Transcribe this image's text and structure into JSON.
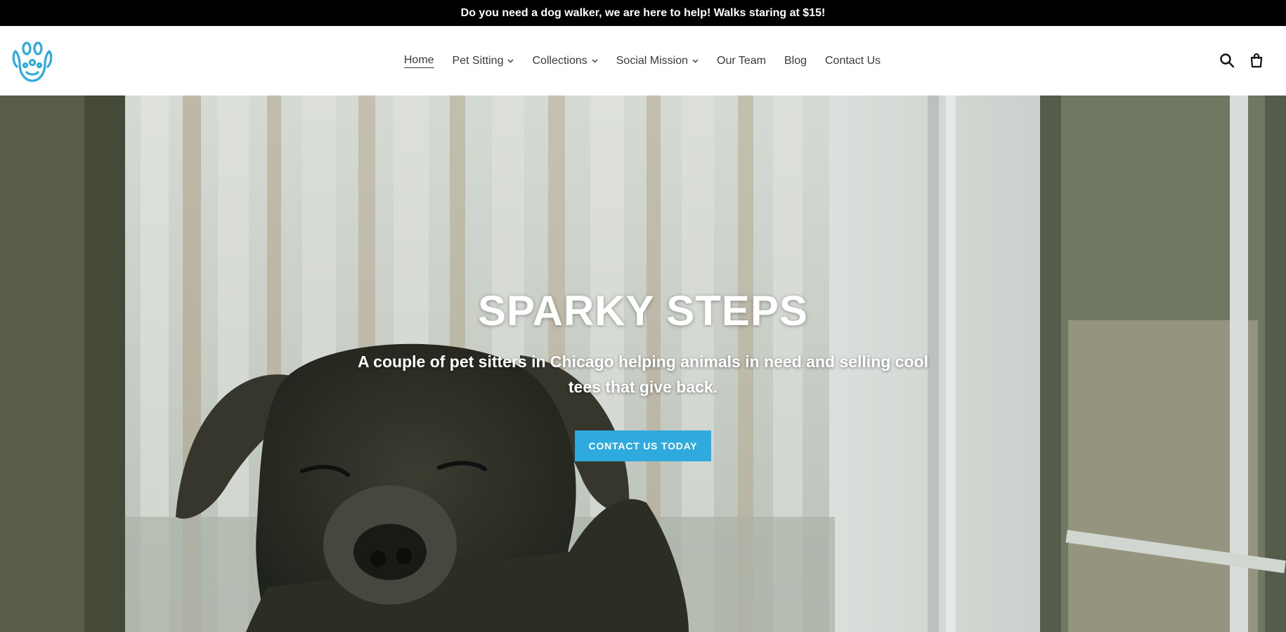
{
  "announcement": {
    "text": "Do you need a dog walker, we are here to help! Walks staring at $15!"
  },
  "header": {
    "logo_icon": "paw-logo-icon",
    "nav": [
      {
        "label": "Home",
        "active": true,
        "dropdown": false
      },
      {
        "label": "Pet Sitting",
        "active": false,
        "dropdown": true
      },
      {
        "label": "Collections",
        "active": false,
        "dropdown": true
      },
      {
        "label": "Social Mission",
        "active": false,
        "dropdown": true
      },
      {
        "label": "Our Team",
        "active": false,
        "dropdown": false
      },
      {
        "label": "Blog",
        "active": false,
        "dropdown": false
      },
      {
        "label": "Contact Us",
        "active": false,
        "dropdown": false
      }
    ],
    "icons": [
      "search-icon",
      "cart-icon"
    ]
  },
  "hero": {
    "title": "SPARKY STEPS",
    "subtitle": "A couple of pet sitters in Chicago helping animals in need and selling cool tees that give back.",
    "button_label": "CONTACT US TODAY"
  },
  "colors": {
    "accent": "#2eaadf",
    "announcement_bg": "#000000",
    "nav_text": "#3a3a3a"
  }
}
